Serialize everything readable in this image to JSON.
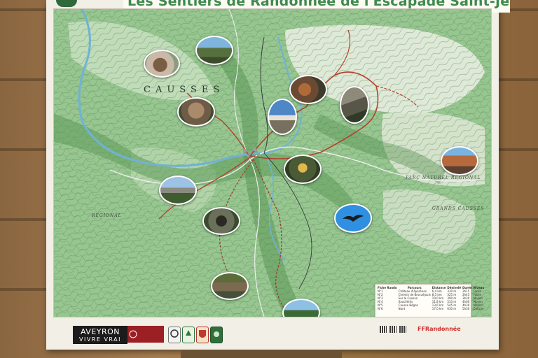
{
  "sign": {
    "title": "Les Sentiers de Randonnée de l'Escapade Saint-Jeantaise",
    "region_label_causses": "CAUSSES",
    "label_parc": "PARC NATUREL RÉGIONAL",
    "label_regional": "REGIONAL",
    "label_grands_causses": "GRANDS CAUSSES"
  },
  "legend": {
    "headers": [
      "Fiche Rando",
      "Parcours",
      "Distance",
      "Dénivelé",
      "Durée",
      "Niveau"
    ],
    "rows": [
      [
        "N°1",
        "Château d'Ayssènes",
        "6,4 km",
        "330 m",
        "2h15",
        "Facile"
      ],
      [
        "N°2",
        "Chemin de Brocuéjouls",
        "8,5 km",
        "325 m",
        "2h45",
        "Facile"
      ],
      [
        "N°3",
        "Sur le Causse",
        "10,0 km",
        "390 m",
        "3h30",
        "Moyen"
      ],
      [
        "N°4",
        "Saucliérès",
        "11,8 km",
        "533 m",
        "4h00",
        "Moyen"
      ],
      [
        "N°5",
        "Causse Bégon",
        "13,6 km",
        "545 m",
        "4h30",
        "Moyen"
      ],
      [
        "N°6",
        "Nant",
        "17,0 km",
        "630 m",
        "5h30",
        "Difficile"
      ]
    ]
  },
  "logos": {
    "aveyron_line1": "AVEYRON",
    "aveyron_line2": "VIVRE VRAI",
    "ffrandonnee": "FFRandonnée"
  },
  "colors": {
    "map_green": "#8fc08a",
    "river": "#6fb2d8",
    "trail": "#b3412f",
    "title_green": "#3f8a4e",
    "bird_circle": "#2f8fe0"
  }
}
